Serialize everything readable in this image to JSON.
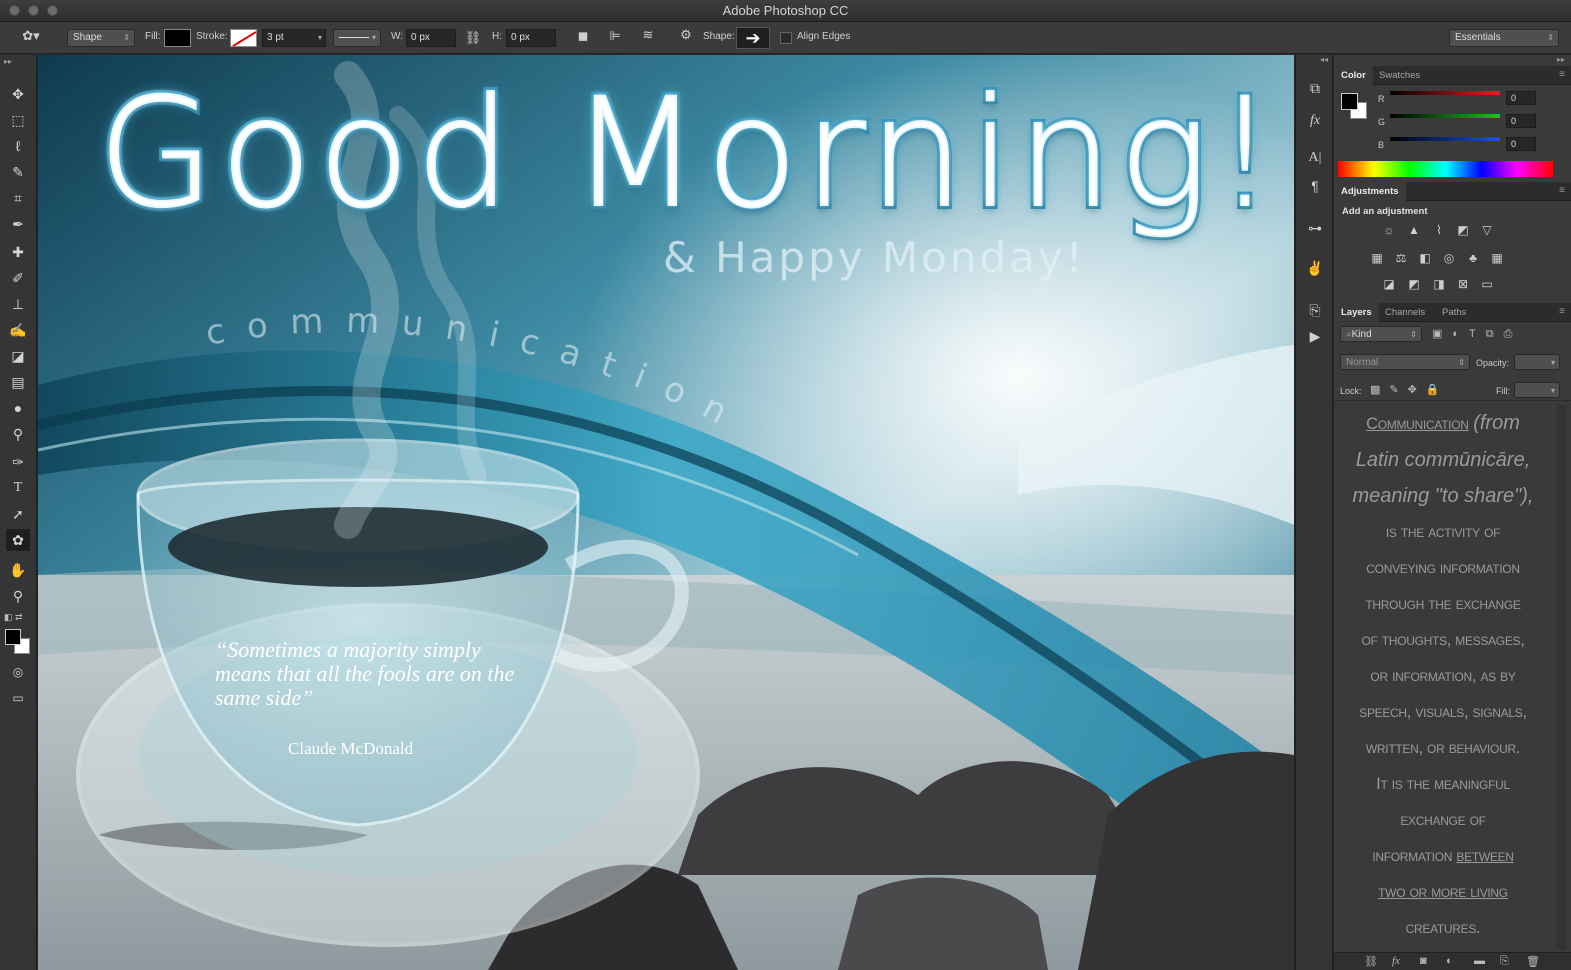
{
  "window": {
    "title": "Adobe Photoshop CC"
  },
  "options_bar": {
    "tool_mode": "Shape",
    "fill_label": "Fill:",
    "stroke_label": "Stroke:",
    "stroke_width": "3 pt",
    "w_label": "W:",
    "w_value": "0 px",
    "h_label": "H:",
    "h_value": "0 px",
    "shape_label": "Shape:",
    "align_edges_label": "Align Edges",
    "workspace": "Essentials"
  },
  "canvas": {
    "headline": "Good  Morning!",
    "subheadline": "& Happy  Monday!",
    "arc_text": "communication",
    "quote": "“Sometimes a majority simply means that all the fools are on the same side”",
    "author": "Claude McDonald"
  },
  "color_panel": {
    "tabs": [
      "Color",
      "Swatches"
    ],
    "channels": [
      {
        "label": "R",
        "value": "0",
        "color": "#e02020"
      },
      {
        "label": "G",
        "value": "0",
        "color": "#20c020"
      },
      {
        "label": "B",
        "value": "0",
        "color": "#2050e0"
      }
    ]
  },
  "adjustments_panel": {
    "tab": "Adjustments",
    "heading": "Add an adjustment"
  },
  "layers_panel": {
    "tabs": [
      "Layers",
      "Channels",
      "Paths"
    ],
    "filter_kind": "Kind",
    "blend_mode": "Normal",
    "opacity_label": "Opacity:",
    "lock_label": "Lock:",
    "fill_label": "Fill:",
    "text_lines": [
      "Communication (from",
      "Latin commūnicāre,",
      "meaning \"to share\"),",
      "is the activity of",
      "conveying information",
      "through the exchange",
      "of thoughts, messages,",
      "or information, as by",
      "speech, visuals, signals,",
      "written, or behaviour.",
      "It is the meaningful",
      "exchange of",
      "information between",
      "two or more living",
      "creatures."
    ]
  }
}
